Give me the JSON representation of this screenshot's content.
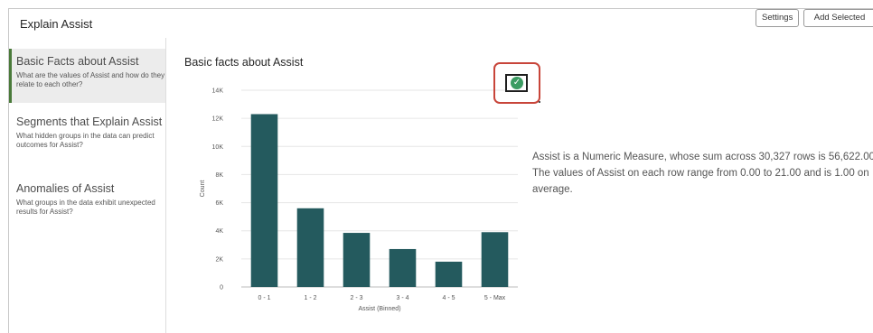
{
  "app": {
    "title": "Explain Assist"
  },
  "toolbar": {
    "settings_label": "Settings",
    "add_selected_label": "Add Selected"
  },
  "sidebar": {
    "items": [
      {
        "title": "Basic Facts about Assist",
        "description": "What are the values of Assist and how do they relate to each other?"
      },
      {
        "title": "Segments that Explain Assist",
        "description": "What hidden groups in the data can predict outcomes for Assist?"
      },
      {
        "title": "Anomalies of Assist",
        "description": "What groups in the data exhibit unexpected results for Assist?"
      }
    ]
  },
  "main": {
    "heading": "Basic facts about Assist",
    "check_icon": "check-circle-icon",
    "summary_lines": [
      "Assist is a Numeric Measure, whose sum across 30,327 rows is 56,622.00",
      "The values of Assist on each row range from 0.00 to 21.00 and is 1.00 on",
      "average."
    ]
  },
  "colors": {
    "bar": "#245a5e",
    "check": "#3b9c62",
    "highlight": "#c8453a"
  },
  "chart_data": {
    "type": "bar",
    "categories": [
      "0 - 1",
      "1 - 2",
      "2 - 3",
      "3 - 4",
      "4 - 5",
      "5 - Max"
    ],
    "values": [
      12300,
      5600,
      3850,
      2700,
      1800,
      3900
    ],
    "xlabel": "Assist (Binned)",
    "ylabel": "Count",
    "ylim": [
      0,
      14000
    ],
    "yticks": [
      0,
      2000,
      4000,
      6000,
      8000,
      10000,
      12000,
      14000
    ],
    "ytick_labels": [
      "0",
      "2K",
      "4K",
      "6K",
      "8K",
      "10K",
      "12K",
      "14K"
    ],
    "grid": true
  }
}
